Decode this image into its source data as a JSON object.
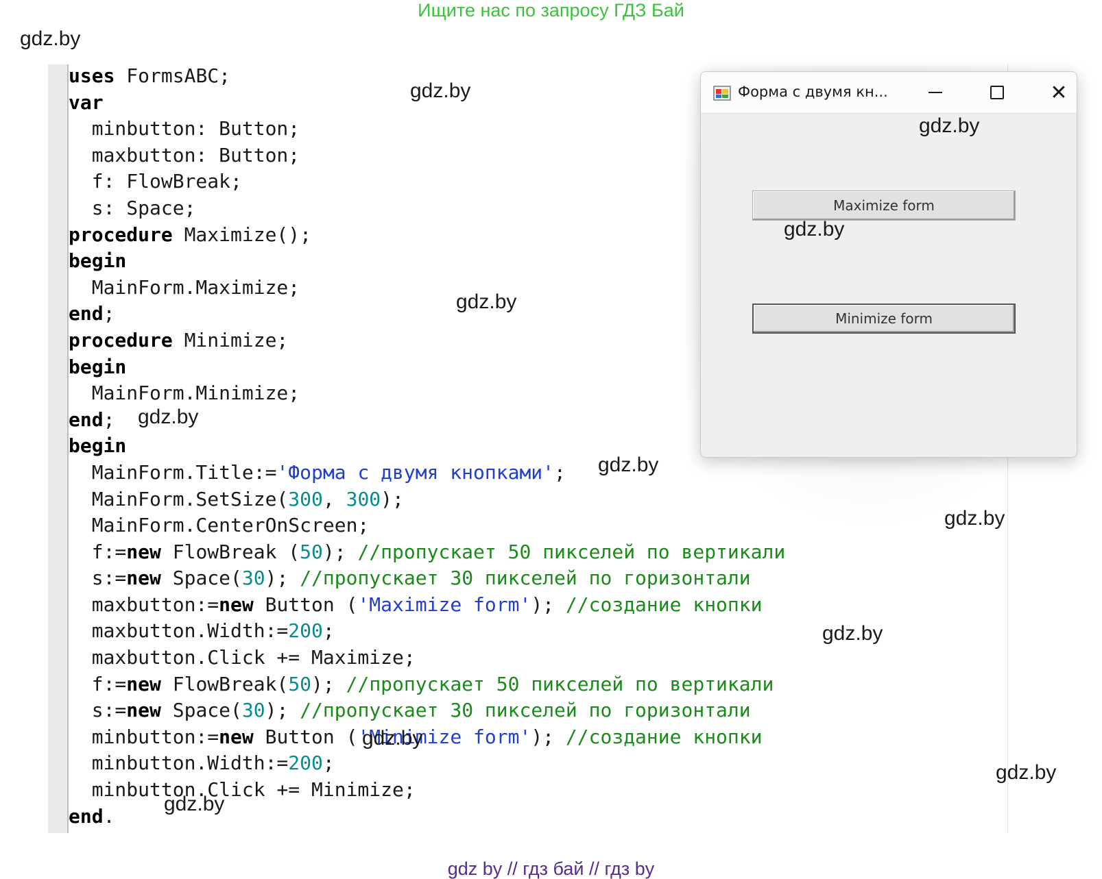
{
  "banner": "Ищите нас по запросу ГДЗ Бай",
  "footer": "gdz by  //  гдз бай  //  гдз by",
  "watermark": "gdz.by",
  "code": {
    "l1a": "uses",
    "l1b": " FormsABC;",
    "l2": "var",
    "l3": "  minbutton: Button;",
    "l4": "  maxbutton: Button;",
    "l5": "  f: FlowBreak;",
    "l6": "  s: Space;",
    "l7a": "procedure",
    "l7b": " Maximize();",
    "l8": "begin",
    "l9": "  MainForm.Maximize;",
    "l10": "end",
    "l11a": "procedure",
    "l11b": " Minimize;",
    "l12": "begin",
    "l13": "  MainForm.Minimize;",
    "l14": "end",
    "l15": "begin",
    "l16a": "  MainForm.Title:=",
    "l16s": "'Форма с двумя кнопками'",
    "l16c": ";",
    "l17a": "  MainForm.SetSize(",
    "l17n1": "300",
    "l17b": ", ",
    "l17n2": "300",
    "l17c": ");",
    "l18": "  MainForm.CenterOnScreen;",
    "l19a": "  f:=",
    "l19k": "new",
    "l19b": " FlowBreak (",
    "l19n": "50",
    "l19c": "); ",
    "l19cm": "//пропускает 50 пикселей по вертикали",
    "l20a": "  s:=",
    "l20k": "new",
    "l20b": " Space(",
    "l20n": "30",
    "l20c": "); ",
    "l20cm": "//пропускает 30 пикселей по горизонтали",
    "l21a": "  maxbutton:=",
    "l21k": "new",
    "l21b": " Button (",
    "l21s": "'Maximize form'",
    "l21c": "); ",
    "l21cm": "//создание кнопки",
    "l22a": "  maxbutton.Width:=",
    "l22n": "200",
    "l22c": ";",
    "l23": "  maxbutton.Click += Maximize;",
    "l24a": "  f:=",
    "l24k": "new",
    "l24b": " FlowBreak(",
    "l24n": "50",
    "l24c": "); ",
    "l24cm": "//пропускает 50 пикселей по вертикали",
    "l25a": "  s:=",
    "l25k": "new",
    "l25b": " Space(",
    "l25n": "30",
    "l25c": "); ",
    "l25cm": "//пропускает 30 пикселей по горизонтали",
    "l26a": "  minbutton:=",
    "l26k": "new",
    "l26b": " Button (",
    "l26s": "'Minimize form'",
    "l26c": "); ",
    "l26cm": "//создание кнопки",
    "l27a": "  minbutton.Width:=",
    "l27n": "200",
    "l27c": ";",
    "l28": "  minbutton.Click += Minimize;",
    "l29": "end"
  },
  "window": {
    "title": "Форма с двумя кн...",
    "minimize_icon": "minimize-icon",
    "maximize_icon": "maximize-icon",
    "close_glyph": "✕",
    "maximize_button": "Maximize form",
    "minimize_button": "Minimize form"
  },
  "colors": {
    "banner": "#3ac33a",
    "footer": "#5a2a8a",
    "string": "#1f3fd0",
    "number": "#0a8a8a",
    "comment": "#1a8a1a"
  }
}
